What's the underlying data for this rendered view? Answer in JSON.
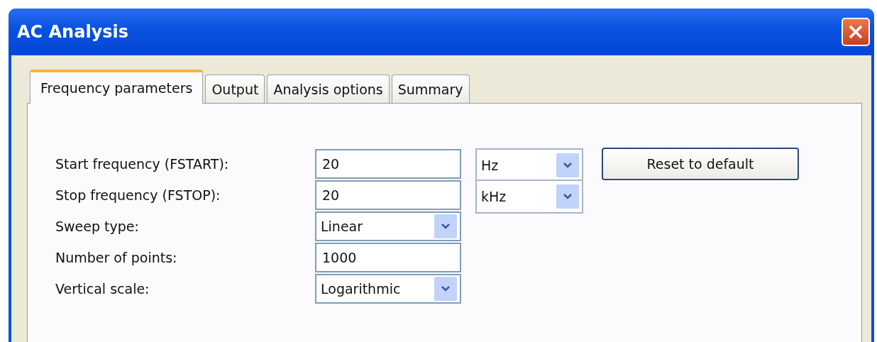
{
  "window": {
    "title": "AC Analysis"
  },
  "tabs": [
    {
      "label": "Frequency parameters",
      "selected": true
    },
    {
      "label": "Output",
      "selected": false
    },
    {
      "label": "Analysis options",
      "selected": false
    },
    {
      "label": "Summary",
      "selected": false
    }
  ],
  "rows": [
    {
      "label": "Start frequency (FSTART):",
      "kind": "text",
      "value": "20",
      "unit": "Hz"
    },
    {
      "label": "Stop frequency (FSTOP):",
      "kind": "text",
      "value": "20",
      "unit": "kHz"
    },
    {
      "label": "Sweep type:",
      "kind": "select",
      "value": "Linear"
    },
    {
      "label": "Number of points:",
      "kind": "text",
      "value": "1000"
    },
    {
      "label": "Vertical scale:",
      "kind": "select",
      "value": "Logarithmic"
    }
  ],
  "reset_button": "Reset to default"
}
